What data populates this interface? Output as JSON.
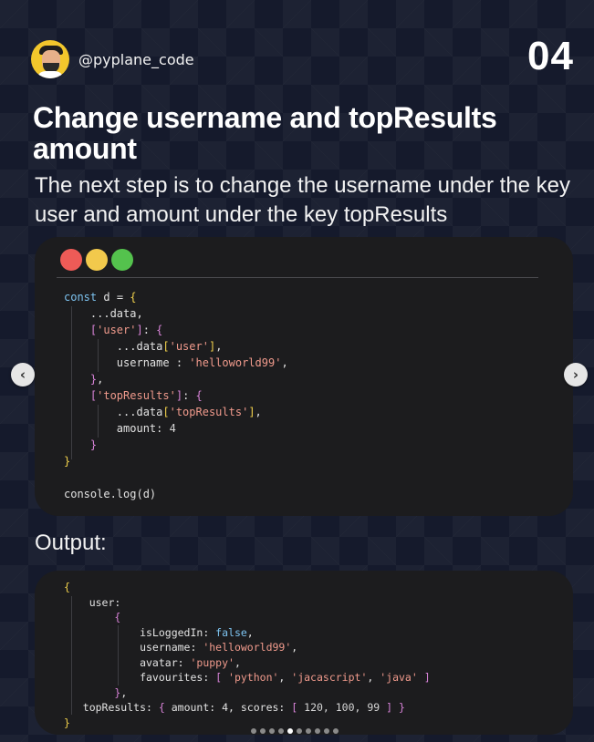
{
  "header": {
    "handle": "@pyplane_code",
    "page_number": "04",
    "avatar_icon": "profile-avatar-icon"
  },
  "title": "Change username and topResults amount",
  "subtitle": "The next step is to change the username under the key user and amount under the key topResults",
  "code_window": {
    "dots": [
      "#ee5b57",
      "#f2c94c",
      "#54c24d"
    ],
    "lines": [
      [
        {
          "t": "const",
          "c": "kw"
        },
        {
          "t": " d ",
          "c": "var"
        },
        {
          "t": "=",
          "c": "var"
        },
        {
          "t": " {",
          "c": "br1"
        }
      ],
      [
        {
          "t": "    ...data,",
          "c": "var"
        }
      ],
      [
        {
          "t": "    [",
          "c": "br2"
        },
        {
          "t": "'user'",
          "c": "str"
        },
        {
          "t": "]",
          "c": "br2"
        },
        {
          "t": ": ",
          "c": "var"
        },
        {
          "t": "{",
          "c": "br2"
        }
      ],
      [
        {
          "t": "        ...data",
          "c": "var"
        },
        {
          "t": "[",
          "c": "br1"
        },
        {
          "t": "'user'",
          "c": "str"
        },
        {
          "t": "]",
          "c": "br1"
        },
        {
          "t": ",",
          "c": "var"
        }
      ],
      [
        {
          "t": "        username : ",
          "c": "var"
        },
        {
          "t": "'helloworld99'",
          "c": "str"
        },
        {
          "t": ",",
          "c": "var"
        }
      ],
      [
        {
          "t": "    }",
          "c": "br2"
        },
        {
          "t": ",",
          "c": "var"
        }
      ],
      [
        {
          "t": "    [",
          "c": "br2"
        },
        {
          "t": "'topResults'",
          "c": "str"
        },
        {
          "t": "]",
          "c": "br2"
        },
        {
          "t": ": ",
          "c": "var"
        },
        {
          "t": "{",
          "c": "br2"
        }
      ],
      [
        {
          "t": "        ...data",
          "c": "var"
        },
        {
          "t": "[",
          "c": "br1"
        },
        {
          "t": "'topResults'",
          "c": "str"
        },
        {
          "t": "]",
          "c": "br1"
        },
        {
          "t": ",",
          "c": "var"
        }
      ],
      [
        {
          "t": "        amount: ",
          "c": "var"
        },
        {
          "t": "4",
          "c": "num"
        }
      ],
      [
        {
          "t": "    }",
          "c": "br2"
        }
      ],
      [
        {
          "t": "}",
          "c": "br1"
        }
      ],
      [
        {
          "t": "",
          "c": "var"
        }
      ],
      [
        {
          "t": "console.",
          "c": "var"
        },
        {
          "t": "log",
          "c": "var"
        },
        {
          "t": "(d)",
          "c": "var"
        }
      ]
    ]
  },
  "output_label": "Output:",
  "output_window": {
    "lines": [
      [
        {
          "t": "{",
          "c": "br1"
        }
      ],
      [
        {
          "t": "    user:",
          "c": "var"
        }
      ],
      [
        {
          "t": "        {",
          "c": "br2"
        }
      ],
      [
        {
          "t": "            isLoggedIn: ",
          "c": "var"
        },
        {
          "t": "false",
          "c": "bool"
        },
        {
          "t": ",",
          "c": "var"
        }
      ],
      [
        {
          "t": "            username: ",
          "c": "var"
        },
        {
          "t": "'helloworld99'",
          "c": "str"
        },
        {
          "t": ",",
          "c": "var"
        }
      ],
      [
        {
          "t": "            avatar: ",
          "c": "var"
        },
        {
          "t": "'puppy'",
          "c": "str"
        },
        {
          "t": ",",
          "c": "var"
        }
      ],
      [
        {
          "t": "            favourites: ",
          "c": "var"
        },
        {
          "t": "[ ",
          "c": "br2"
        },
        {
          "t": "'python'",
          "c": "str"
        },
        {
          "t": ", ",
          "c": "var"
        },
        {
          "t": "'jacascript'",
          "c": "str"
        },
        {
          "t": ", ",
          "c": "var"
        },
        {
          "t": "'java'",
          "c": "str"
        },
        {
          "t": " ]",
          "c": "br2"
        }
      ],
      [
        {
          "t": "        }",
          "c": "br2"
        },
        {
          "t": ",",
          "c": "var"
        }
      ],
      [
        {
          "t": "   topResults: ",
          "c": "var"
        },
        {
          "t": "{ ",
          "c": "br2"
        },
        {
          "t": "amount: 4, scores: ",
          "c": "var"
        },
        {
          "t": "[ ",
          "c": "br2"
        },
        {
          "t": "120, 100, 99",
          "c": "num"
        },
        {
          "t": " ]",
          "c": "br2"
        },
        {
          "t": " }",
          "c": "br2"
        }
      ],
      [
        {
          "t": "}",
          "c": "br1"
        }
      ]
    ]
  },
  "navigation": {
    "prev_icon": "chevron-left-icon",
    "next_icon": "chevron-right-icon",
    "prev_glyph": "‹",
    "next_glyph": "›"
  },
  "pagination": {
    "total": 10,
    "active_index": 4
  }
}
